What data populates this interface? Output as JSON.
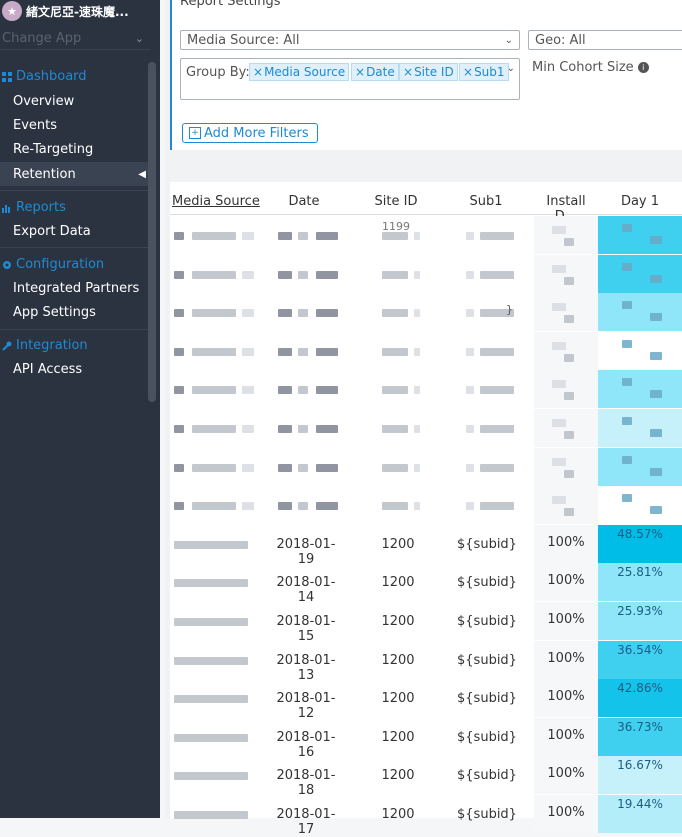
{
  "sidebar": {
    "app_name": "緒文尼亞-速珠魔...",
    "change_app": "Change App",
    "sections": {
      "dashboard": "Dashboard",
      "reports": "Reports",
      "configuration": "Configuration",
      "integration": "Integration"
    },
    "items": {
      "overview": "Overview",
      "events": "Events",
      "retargeting": "Re-Targeting",
      "retention": "Retention",
      "export_data": "Export Data",
      "integrated_partners": "Integrated Partners",
      "app_settings": "App Settings",
      "api_access": "API Access"
    }
  },
  "settings": {
    "title": "Report Settings",
    "media_source": "Media Source: All",
    "geo": "Geo: All",
    "group_by_label": "Group By:",
    "chips": [
      "Media Source",
      "Date",
      "Site ID",
      "Sub1"
    ],
    "min_cohort": "Min Cohort Size",
    "add_filters": "Add More Filters"
  },
  "table": {
    "headers": [
      "Media Source",
      "Date",
      "Site ID",
      "Sub1",
      "Install D...",
      "Day 1"
    ],
    "rows": [
      {
        "date": "2018-01-19",
        "site": "1200",
        "sub": "${subid}",
        "install": "100%",
        "day1": "48.57%",
        "color": "#00bde8"
      },
      {
        "date": "2018-01-14",
        "site": "1200",
        "sub": "${subid}",
        "install": "100%",
        "day1": "25.81%",
        "color": "#8fe6f8"
      },
      {
        "date": "2018-01-15",
        "site": "1200",
        "sub": "${subid}",
        "install": "100%",
        "day1": "25.93%",
        "color": "#8fe6f8"
      },
      {
        "date": "2018-01-13",
        "site": "1200",
        "sub": "${subid}",
        "install": "100%",
        "day1": "36.54%",
        "color": "#3fd0ef"
      },
      {
        "date": "2018-01-12",
        "site": "1200",
        "sub": "${subid}",
        "install": "100%",
        "day1": "42.86%",
        "color": "#14c3ea"
      },
      {
        "date": "2018-01-16",
        "site": "1200",
        "sub": "${subid}",
        "install": "100%",
        "day1": "36.73%",
        "color": "#3fd0ef"
      },
      {
        "date": "2018-01-18",
        "site": "1200",
        "sub": "${subid}",
        "install": "100%",
        "day1": "16.67%",
        "color": "#c6f1fb"
      },
      {
        "date": "2018-01-17",
        "site": "1200",
        "sub": "${subid}",
        "install": "100%",
        "day1": "19.44%",
        "color": "#b4edfa"
      }
    ],
    "blurred_day1_colors": [
      "#3fd0ef",
      "#3fd0ef",
      "#8fe6f8",
      "#ffffff",
      "#8fe6f8",
      "#c6f1fb",
      "#8fe6f8",
      "#ffffff"
    ],
    "blurred_site_fragment": "1199",
    "blurred_sub_fragment": "}"
  }
}
